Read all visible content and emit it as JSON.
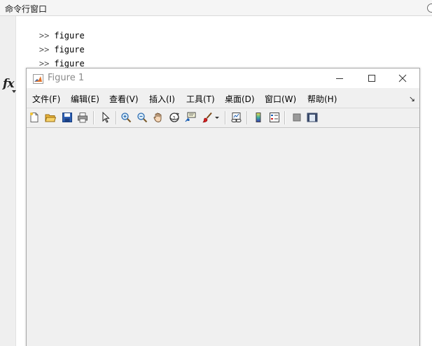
{
  "command_window": {
    "title": "命令行窗口",
    "lines": [
      {
        "prompt": ">>",
        "text": "figure"
      },
      {
        "prompt": ">>",
        "text": "figure"
      },
      {
        "prompt": ">>",
        "text": "figure"
      },
      {
        "prompt": ">>",
        "text": ""
      }
    ],
    "fx_label": "fx"
  },
  "figure_window": {
    "title": "Figure 1",
    "menus": [
      {
        "label": "文件(F)"
      },
      {
        "label": "编辑(E)"
      },
      {
        "label": "查看(V)"
      },
      {
        "label": "插入(I)"
      },
      {
        "label": "工具(T)"
      },
      {
        "label": "桌面(D)"
      },
      {
        "label": "窗口(W)"
      },
      {
        "label": "帮助(H)"
      }
    ],
    "dock_glyph": "↘",
    "toolbar": [
      {
        "icon": "new-figure-icon"
      },
      {
        "icon": "open-file-icon"
      },
      {
        "icon": "save-icon"
      },
      {
        "icon": "print-icon"
      },
      {
        "icon": "pointer-icon"
      },
      {
        "icon": "zoom-in-icon"
      },
      {
        "icon": "zoom-out-icon"
      },
      {
        "icon": "pan-hand-icon"
      },
      {
        "icon": "rotate-3d-icon"
      },
      {
        "icon": "data-cursor-icon"
      },
      {
        "icon": "brush-icon"
      },
      {
        "icon": "link-plot-icon"
      },
      {
        "icon": "colorbar-icon"
      },
      {
        "icon": "legend-icon"
      },
      {
        "icon": "hide-plot-tools-icon"
      },
      {
        "icon": "show-plot-tools-icon"
      }
    ]
  },
  "colors": {
    "panel_header": "#f5f5f5",
    "figure_bg": "#f0f0f0",
    "title_gray": "#8a8a8a"
  }
}
